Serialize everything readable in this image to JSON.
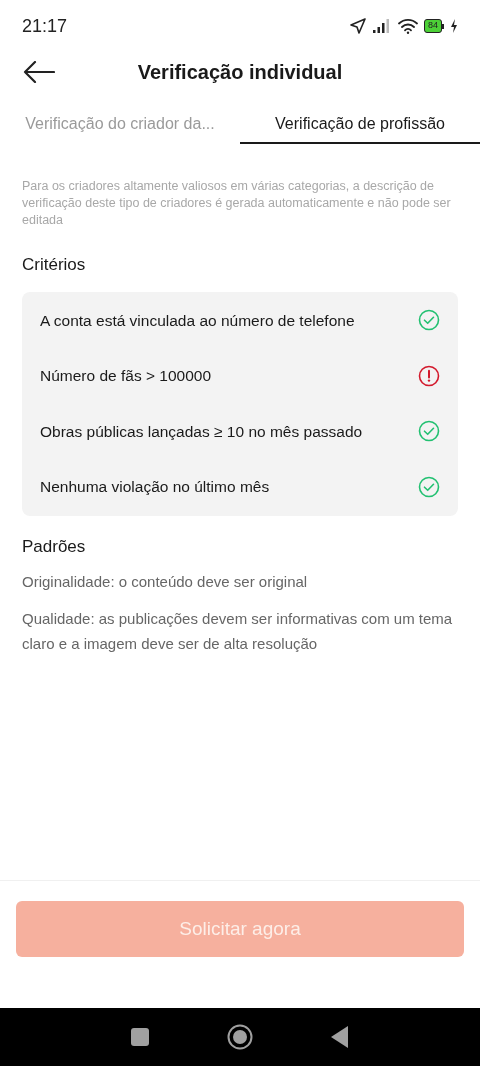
{
  "status_bar": {
    "time": "21:17",
    "battery": "84"
  },
  "header": {
    "title": "Verificação individual"
  },
  "tabs": [
    {
      "label": "Verificação do criador da...",
      "selected": false
    },
    {
      "label": "Verificação de profissão",
      "selected": true
    }
  ],
  "description": "Para os criadores altamente valiosos em várias categorias, a descrição de verificação deste tipo de criadores é gerada automaticamente e não pode ser editada",
  "criteria": {
    "title": "Critérios",
    "items": [
      {
        "label": "A conta está vinculada ao número de telefone",
        "met": true
      },
      {
        "label": "Número de fãs > 100000",
        "met": false
      },
      {
        "label": "Obras públicas lançadas ≥ 10 no mês passado",
        "met": true
      },
      {
        "label": "Nenhuma violação no último mês",
        "met": true
      }
    ]
  },
  "standards": {
    "title": "Padrões",
    "items": [
      "Originalidade: o conteúdo deve ser original",
      "Qualidade: as publicações devem ser informativas com um tema claro e a imagem deve ser de alta resolução"
    ]
  },
  "apply_button": {
    "label": "Solicitar agora",
    "disabled": true
  }
}
